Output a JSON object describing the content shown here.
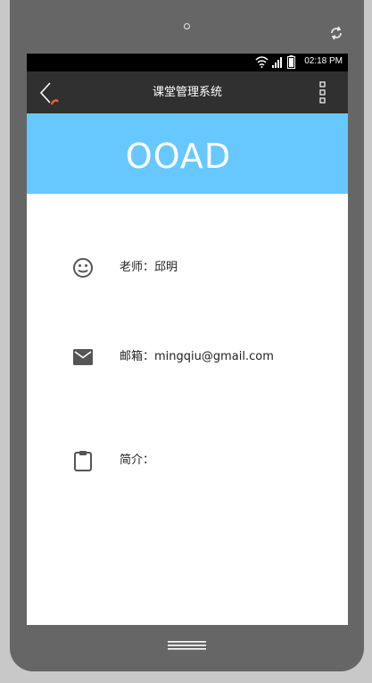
{
  "status_bar": {
    "time": "02:18 PM"
  },
  "app_bar": {
    "title": "课堂管理系统"
  },
  "course": {
    "name": "OOAD"
  },
  "details": {
    "teacher_label": "老师：",
    "teacher_value": "邱明",
    "email_label": "邮箱：",
    "email_value": "mingqiu@gmail.com",
    "intro_label": "简介：",
    "intro_value": ""
  },
  "icons": {
    "back": "back-arrow-icon",
    "more": "more-vertical-icon",
    "teacher": "smiley-face-icon",
    "email": "envelope-icon",
    "intro": "clipboard-icon"
  },
  "colors": {
    "app_bar": "#303030",
    "banner": "#66c8ff",
    "accent_back": "#ff5a1f"
  }
}
